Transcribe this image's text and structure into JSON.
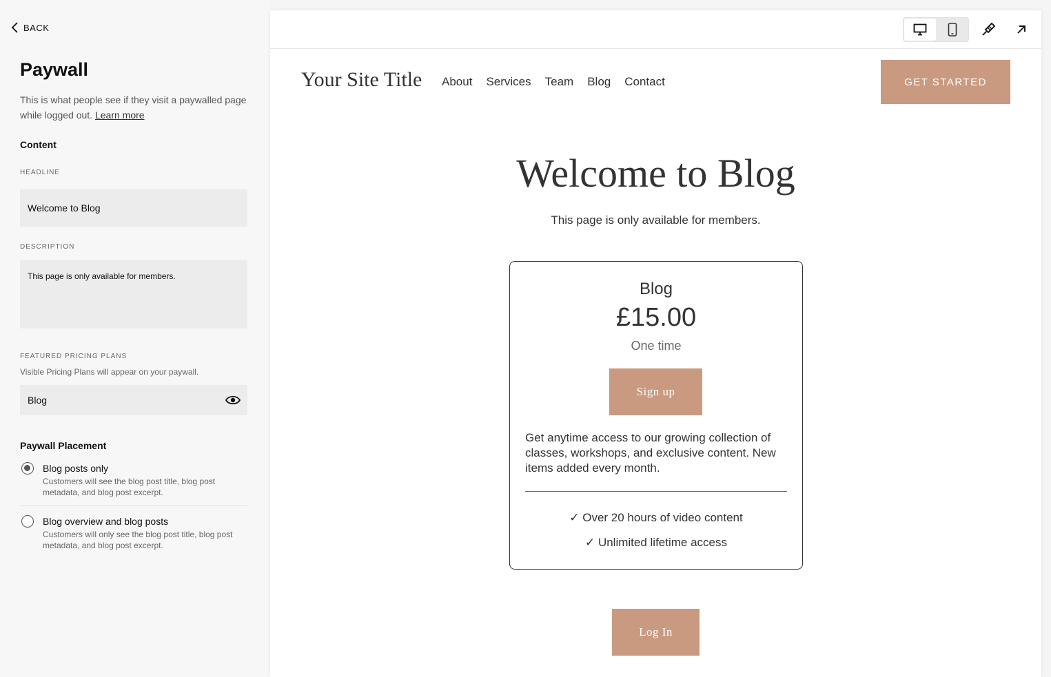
{
  "panel": {
    "back_label": "BACK",
    "title": "Paywall",
    "intro": "This is what people see if they visit a paywalled page while logged out.",
    "learn_more": "Learn more",
    "content_heading": "Content",
    "headline_label": "HEADLINE",
    "headline_value": "Welcome to Blog",
    "description_label": "DESCRIPTION",
    "description_value": "This page is only available for members.",
    "pricing_label": "FEATURED PRICING PLANS",
    "pricing_help": "Visible Pricing Plans will appear on your paywall.",
    "pricing_item": "Blog",
    "placement_heading": "Paywall Placement",
    "placement_options": [
      {
        "label": "Blog posts only",
        "desc": "Customers will see the blog post title, blog post metadata, and blog post excerpt.",
        "selected": true
      },
      {
        "label": "Blog overview and blog posts",
        "desc": "Customers will only see the blog post title, blog post metadata, and blog post excerpt.",
        "selected": false
      }
    ]
  },
  "toolbar": {
    "icons": [
      "desktop-icon",
      "mobile-icon",
      "paintbrush-icon",
      "arrow-up-right-icon"
    ]
  },
  "site": {
    "title": "Your Site Title",
    "nav": [
      "About",
      "Services",
      "Team",
      "Blog",
      "Contact"
    ],
    "cta": "GET STARTED"
  },
  "paywall": {
    "headline": "Welcome to Blog",
    "description": "This page is only available for members.",
    "plan": {
      "name": "Blog",
      "price": "£15.00",
      "term": "One time",
      "signup": "Sign up",
      "description": "Get anytime access to our growing collection of classes, workshops, and exclusive content. New items added every month.",
      "features": [
        "✓ Over 20 hours of video content",
        "✓ Unlimited lifetime access"
      ]
    },
    "login": "Log In"
  },
  "colors": {
    "accent": "#c99a80",
    "text": "#333333",
    "panel_bg": "#f7f7f7"
  }
}
